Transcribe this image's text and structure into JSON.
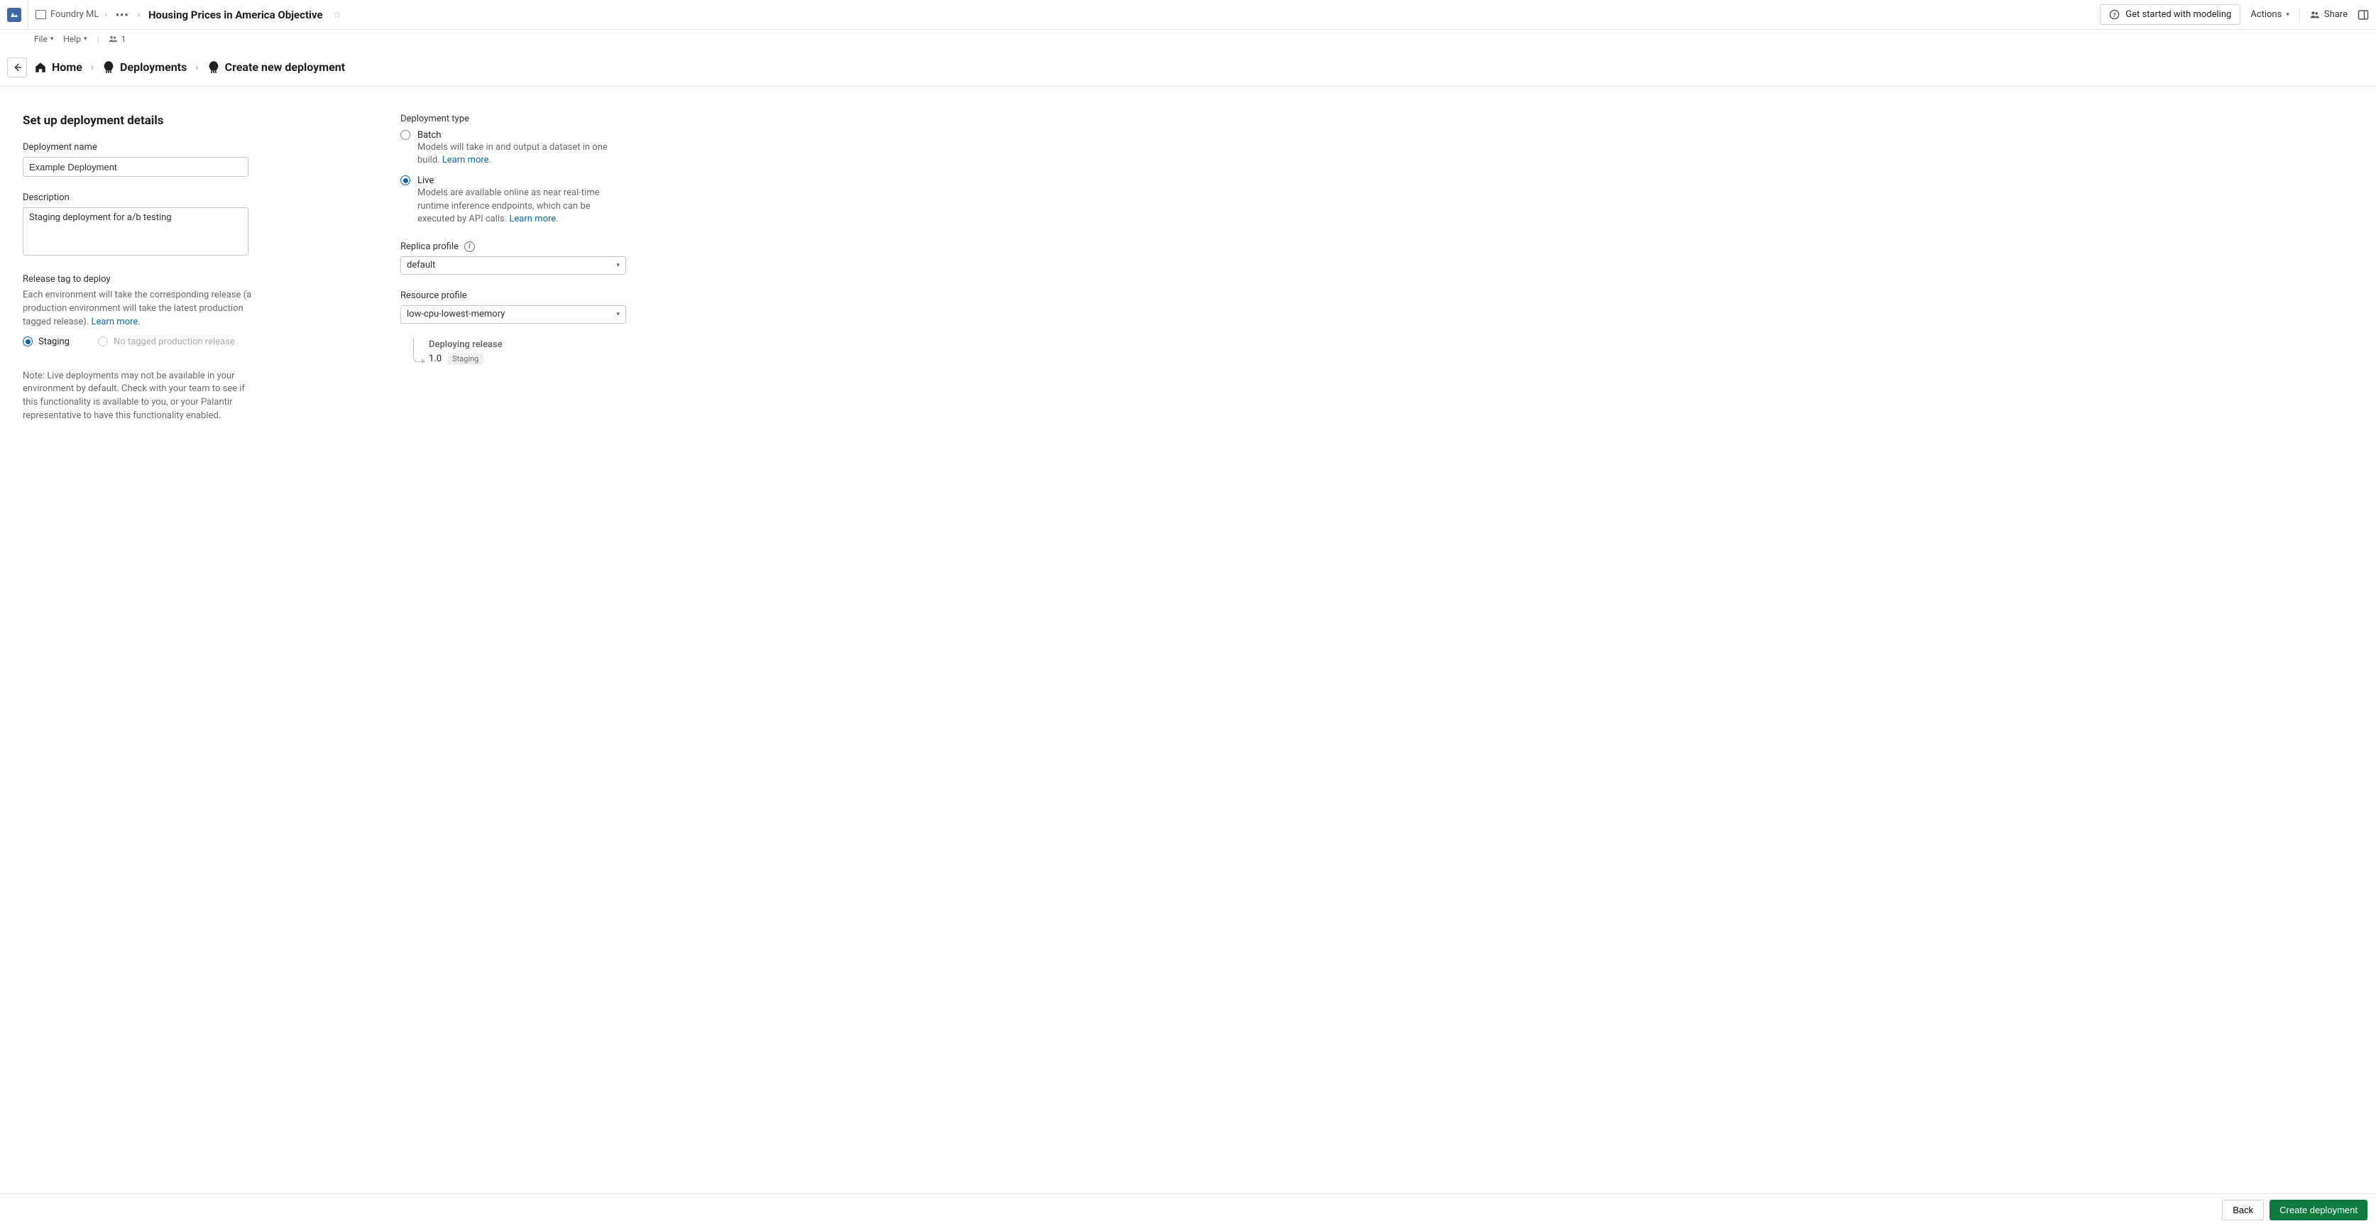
{
  "header": {
    "product": "Foundry ML",
    "pageTitle": "Housing Prices in America Objective",
    "getStarted": "Get started with modeling",
    "actions": "Actions",
    "share": "Share",
    "file": "File",
    "help": "Help",
    "headerCount": "1"
  },
  "breadcrumbs": {
    "home": "Home",
    "deployments": "Deployments",
    "createNew": "Create new deployment"
  },
  "form": {
    "sectionTitle": "Set up deployment details",
    "nameLabel": "Deployment name",
    "nameValue": "Example Deployment",
    "descLabel": "Description",
    "descValue": "Staging deployment for a/b testing",
    "releaseTagLabel": "Release tag to deploy",
    "releaseHelper": "Each environment will take the corresponding release (a production environment will take the latest production tagged release). ",
    "learnMore": "Learn more.",
    "stagingLabel": "Staging",
    "noProdLabel": "No tagged production release",
    "note": "Note: Live deployments may not be available in your environment by default. Check with your team to see if this functionality is available to you, or your Palantir representative to have this functionality enabled."
  },
  "type": {
    "label": "Deployment type",
    "batch": {
      "name": "Batch",
      "desc": "Models will take in and output a dataset in one build. "
    },
    "live": {
      "name": "Live",
      "desc": "Models are available online as near real-time runtime inference endpoints, which can be executed by API calls. "
    },
    "replicaLabel": "Replica profile",
    "replicaValue": "default",
    "resourceLabel": "Resource profile",
    "resourceValue": "low-cpu-lowest-memory"
  },
  "release": {
    "title": "Deploying release",
    "version": "1.0",
    "tag": "Staging"
  },
  "footer": {
    "back": "Back",
    "create": "Create deployment"
  }
}
